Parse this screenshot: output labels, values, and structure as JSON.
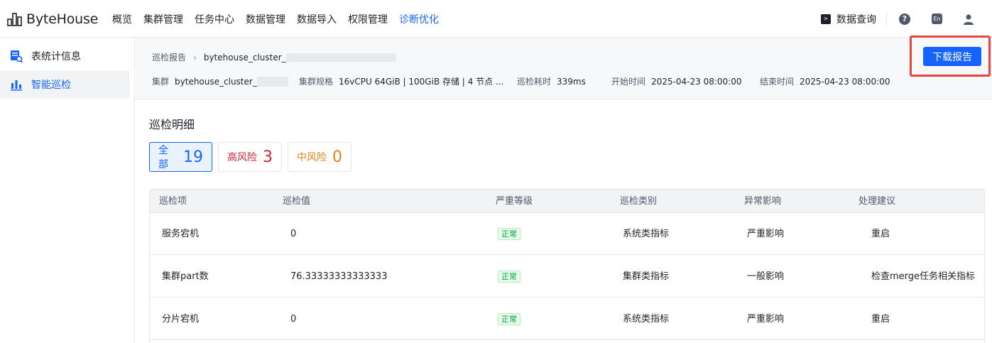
{
  "brand": {
    "name": "ByteHouse"
  },
  "nav": {
    "items": [
      {
        "label": "概览"
      },
      {
        "label": "集群管理"
      },
      {
        "label": "任务中心"
      },
      {
        "label": "数据管理"
      },
      {
        "label": "数据导入"
      },
      {
        "label": "权限管理"
      },
      {
        "label": "诊断优化",
        "active": true
      }
    ]
  },
  "topright": {
    "query_label": "数据查询",
    "help": "?",
    "lang": "En"
  },
  "sidebar": {
    "items": [
      {
        "label": "表统计信息",
        "icon": "table-stats-icon"
      },
      {
        "label": "智能巡检",
        "icon": "bar-chart-icon",
        "active": true
      }
    ]
  },
  "breadcrumb": {
    "parent": "巡检报告",
    "current": "bytehouse_cluster_"
  },
  "meta": {
    "cluster_label": "集群",
    "cluster_value": "bytehouse_cluster_",
    "spec_label": "集群规格",
    "spec_value": "16vCPU 64GiB | 100GiB 存储 | 4 节点 ...",
    "duration_label": "巡检耗时",
    "duration_value": "339ms",
    "start_label": "开始时间",
    "start_value": "2025-04-23 08:00:00",
    "end_label": "结束时间",
    "end_value": "2025-04-23 08:00:00"
  },
  "download_label": "下载报告",
  "details": {
    "title": "巡检明细",
    "filters": {
      "all": {
        "label": "全部",
        "count": "19"
      },
      "high": {
        "label": "高风险",
        "count": "3"
      },
      "mid": {
        "label": "中风险",
        "count": "0"
      }
    }
  },
  "table": {
    "headers": [
      "巡检项",
      "巡检值",
      "严重等级",
      "巡检类别",
      "异常影响",
      "处理建议"
    ],
    "rows": [
      {
        "item": "服务宕机",
        "value": "0",
        "level": "正常",
        "category": "系统类指标",
        "impact": "严重影响",
        "advice": "重启"
      },
      {
        "item": "集群part数",
        "value": "76.33333333333333",
        "level": "正常",
        "category": "集群类指标",
        "impact": "一般影响",
        "advice": "检查merge任务相关指标"
      },
      {
        "item": "分片宕机",
        "value": "0",
        "level": "正常",
        "category": "系统类指标",
        "impact": "严重影响",
        "advice": "重启"
      }
    ]
  }
}
